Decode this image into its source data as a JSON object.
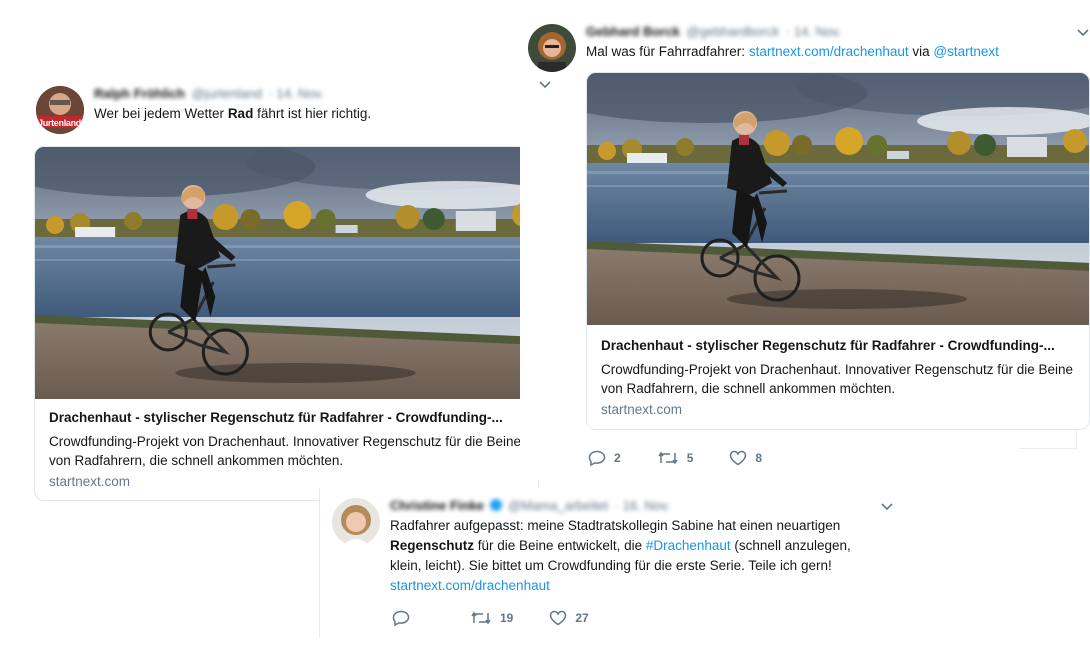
{
  "tweet1": {
    "author_name": "Ralph Fröhlich",
    "author_handle": "@jurtenland",
    "date": "· 14. Nov.",
    "avatar_text": "Jurtenland",
    "text_before": "Wer bei jedem Wetter ",
    "text_bold": "Rad",
    "text_after": " fährt ist hier richtig.",
    "card": {
      "title": "Drachenhaut - stylischer Regenschutz für Radfahrer - Crowdfunding-...",
      "description": "Crowdfunding-Projekt von Drachenhaut. Innovativer Regenschutz für die Beine von Radfahrern, die schnell ankommen möchten.",
      "domain": "startnext.com"
    }
  },
  "tweet2": {
    "author_name": "Gebhard Borck",
    "author_handle": "@gebhardborck",
    "date": "· 14. Nov.",
    "text_before": "Mal was für Fahrradfahrer: ",
    "text_link": "startnext.com/drachenhaut",
    "text_mid": " via ",
    "text_mention": "@startnext",
    "card": {
      "title": "Drachenhaut - stylischer Regenschutz für Radfahrer - Crowdfunding-...",
      "description": "Crowdfunding-Projekt von Drachenhaut. Innovativer Regenschutz für die Beine von Radfahrern, die schnell ankommen möchten.",
      "domain": "startnext.com"
    },
    "replies": "2",
    "retweets": "5",
    "likes": "8"
  },
  "tweet3": {
    "author_name": "Christine Finke",
    "author_handle": "@Mama_arbeitet",
    "date": "· 16. Nov.",
    "line1": "Radfahrer aufgepasst: meine Stadtratskollegin Sabine hat einen neuartigen",
    "line2_bold": "Regenschutz",
    "line2_mid": " für die Beine entwickelt, die ",
    "line2_hashtag": "#Drachenhaut",
    "line2_after": " (schnell anzulegen,",
    "line3": "klein, leicht). Sie bittet um Crowdfunding für die erste Serie. Teile ich gern!",
    "line4_link": "startnext.com/drachenhaut",
    "replies": "",
    "retweets": "19",
    "likes": "27"
  },
  "colors": {
    "link": "#1b95e0",
    "muted": "#657786",
    "border": "#e1e8ed"
  },
  "icons": [
    "chevron-down-icon",
    "reply-icon",
    "retweet-icon",
    "like-icon",
    "verified-icon"
  ]
}
